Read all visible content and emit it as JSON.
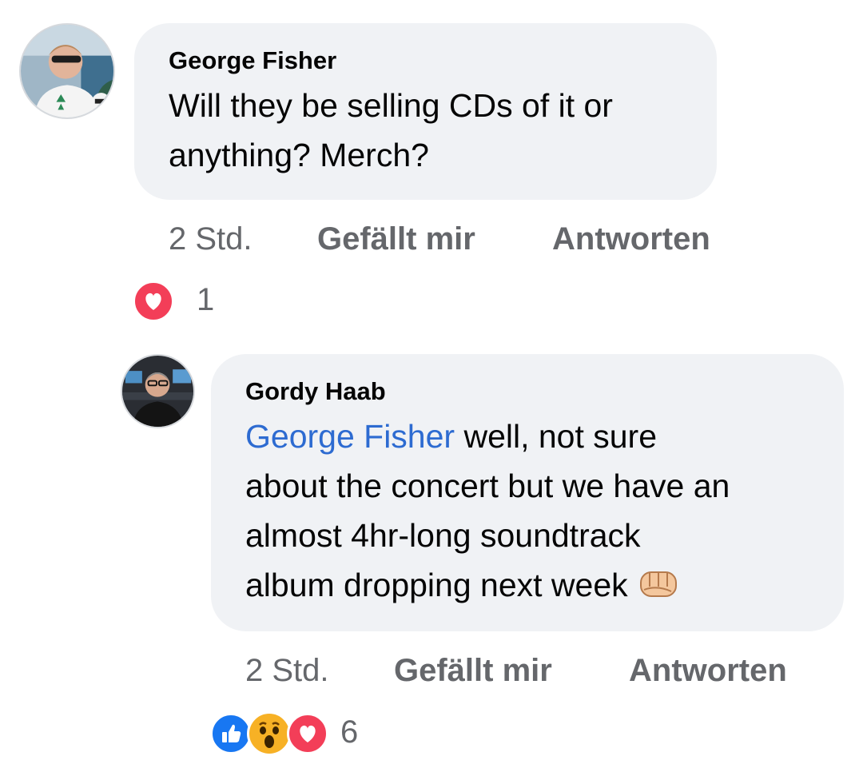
{
  "comments": [
    {
      "author": "George Fisher",
      "text": "Will they be selling CDs of it or anything? Merch?",
      "time": "2 Std.",
      "like_label": "Gefällt mir",
      "reply_label": "Antworten",
      "reactions": [
        "love-icon"
      ],
      "reaction_count": "1"
    },
    {
      "author": "Gordy Haab",
      "mention": "George Fisher",
      "text_line1_rest": " well, not sure",
      "text_line2": "about the concert but we have an",
      "text_line3": "almost 4hr-long soundtrack",
      "text_line4": "album dropping next week",
      "emoji": "fist-bump",
      "time": "2 Std.",
      "like_label": "Gefällt mir",
      "reply_label": "Antworten",
      "reactions": [
        "like-icon",
        "wow-icon",
        "love-icon"
      ],
      "reaction_count": "6"
    }
  ],
  "colors": {
    "bubble": "#f0f2f5",
    "meta": "#65676b",
    "mention": "#2d6bd1",
    "love": "#f33e58",
    "like": "#1877f2",
    "wow": "#f7b125"
  }
}
